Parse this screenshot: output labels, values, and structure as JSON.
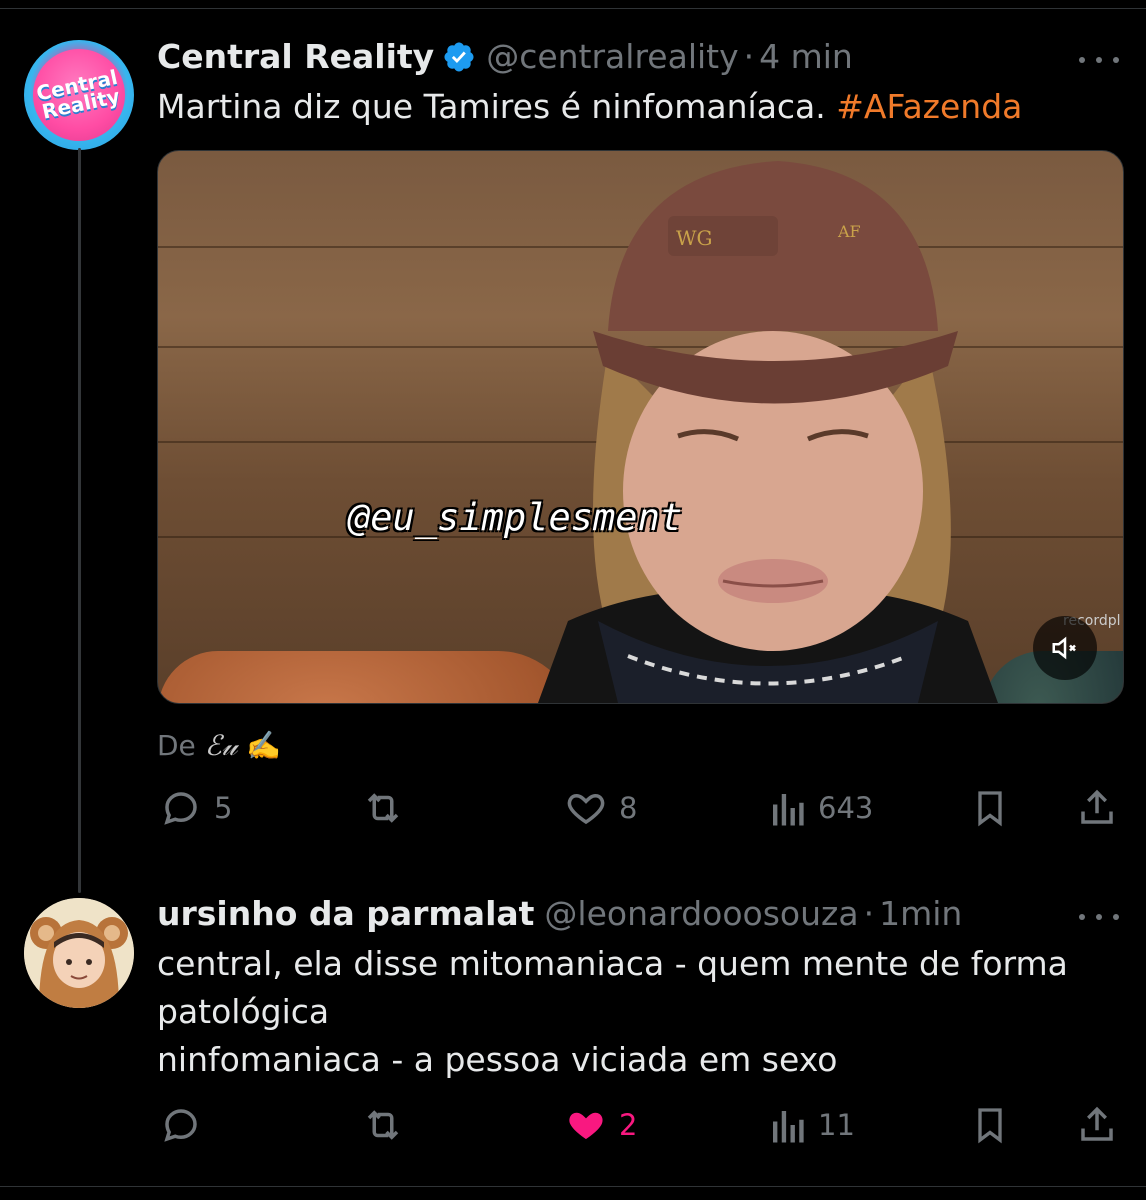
{
  "tweet": {
    "name": "Central Reality",
    "handle": "@centralreality",
    "separator": "·",
    "time": "4 min",
    "avatar_text_line1": "Central",
    "avatar_text_line2": "Reality",
    "text": "Martina diz que Tamires é ninfomaníaca. ",
    "hashtag": "#AFazenda",
    "media": {
      "watermark": "@eu_simplesment",
      "brand": "recordpl",
      "muted": true
    },
    "from_prefix": "De",
    "from_name": "ℰ𝓊",
    "from_emoji": "✍️",
    "stats": {
      "replies": "5",
      "reposts": "",
      "likes": "8",
      "views": "643"
    }
  },
  "reply": {
    "name": "ursinho da parmalat",
    "handle": "@leonardooosouza",
    "separator": "·",
    "time": "1min",
    "text_line1": "central, ela disse mitomaniaca - quem mente de forma",
    "text_line2": "patológica",
    "text_line3": "ninfomaniaca - a pessoa viciada em sexo",
    "stats": {
      "replies": "",
      "reposts": "",
      "likes": "2",
      "views": "11",
      "liked": true
    }
  },
  "colors": {
    "background": "#000000",
    "text": "#e7e9ea",
    "muted": "#71767b",
    "hashtag": "#f07a2a",
    "verified": "#1d9bf0",
    "like_active": "#f91880"
  }
}
